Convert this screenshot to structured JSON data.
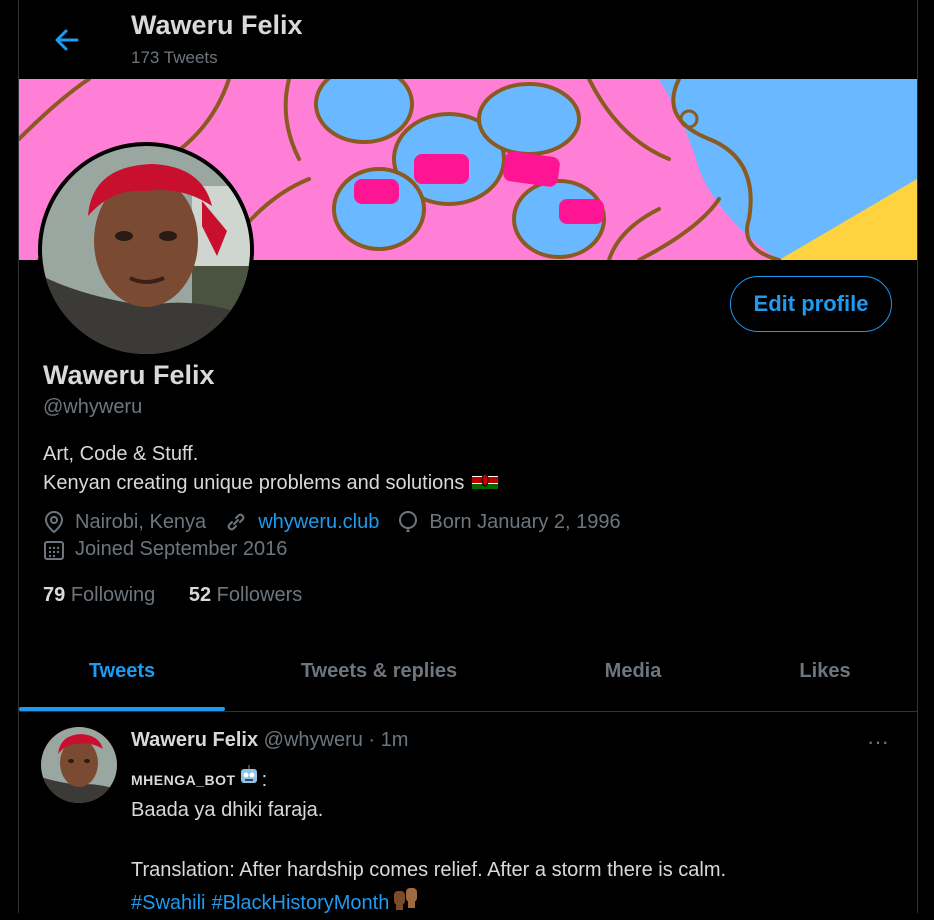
{
  "header": {
    "name": "Waweru Felix",
    "tweet_count": "173 Tweets"
  },
  "profile": {
    "name": "Waweru Felix",
    "handle": "@whyweru",
    "edit_label": "Edit profile",
    "bio_line1": "Art, Code & Stuff.",
    "bio_line2": "Kenyan creating unique problems and solutions",
    "location": "Nairobi, Kenya",
    "website": "whyweru.club",
    "birthday": "Born January 2, 1996",
    "joined": "Joined September 2016",
    "following_count": "79",
    "following_label": "Following",
    "followers_count": "52",
    "followers_label": "Followers"
  },
  "tabs": [
    {
      "label": "Tweets"
    },
    {
      "label": "Tweets & replies"
    },
    {
      "label": "Media"
    },
    {
      "label": "Likes"
    }
  ],
  "tweet": {
    "name": "Waweru Felix",
    "handle": "@whyweru",
    "time": "· 1m",
    "more": "···",
    "bot_name": "MHENGA_BOT",
    "bot_suffix": " :",
    "line1": "Baada ya dhiki faraja.",
    "line2": "Translation: After hardship comes relief. After a storm there is calm.",
    "hashtag1": "#Swahili",
    "hashtag2": "#BlackHistoryMonth"
  },
  "colors": {
    "accent": "#1d9bf0",
    "muted": "#6e767d",
    "text": "#d9d9d9",
    "banner_pink": "#ff7fd6",
    "banner_blue": "#6ab8ff",
    "banner_yellow": "#ffd23f"
  }
}
